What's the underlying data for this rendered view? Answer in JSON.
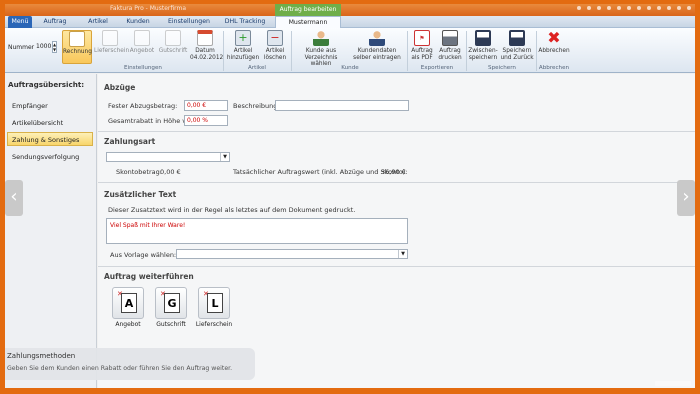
{
  "titlebar": {
    "title": "Faktura Pro - Musterfirma",
    "context_tab": "Auftrag bearbeiten"
  },
  "tabs": [
    "Menü",
    "Auftrag",
    "Artikel",
    "Kunden",
    "Einstellungen",
    "DHL Tracking",
    "Mustermann"
  ],
  "ribbon": {
    "number_label": "Nummer",
    "number_value": "1000",
    "buttons": [
      {
        "label": "Rechnung",
        "icon": "document-r-icon"
      },
      {
        "label": "Lieferschein",
        "icon": "document-l-icon"
      },
      {
        "label": "Angebot",
        "icon": "document-a-icon"
      },
      {
        "label": "Gutschrift",
        "icon": "document-g-icon"
      },
      {
        "label": "Datum",
        "sub": "04.02.2012",
        "icon": "calendar-icon"
      },
      {
        "label": "Artikel",
        "sub": "hinzufügen",
        "icon": "cart-add-icon"
      },
      {
        "label": "Artikel",
        "sub": "löschen",
        "icon": "cart-remove-icon"
      },
      {
        "label": "Kunde aus",
        "sub": "Verzeichnis wählen",
        "icon": "customer-icon"
      },
      {
        "label": "Kundendaten",
        "sub": "selber eintragen",
        "icon": "customer-edit-icon"
      },
      {
        "label": "Auftrag",
        "sub": "als PDF",
        "icon": "pdf-icon"
      },
      {
        "label": "Auftrag",
        "sub": "drucken",
        "icon": "printer-icon"
      },
      {
        "label": "Zwischen-",
        "sub": "speichern",
        "icon": "save-icon"
      },
      {
        "label": "Speichern",
        "sub": "und Zurück",
        "icon": "save-back-icon"
      },
      {
        "label": "Abbrechen",
        "icon": "cancel-icon"
      }
    ],
    "groups": [
      "Einstellungen",
      "Artikel",
      "Kunde",
      "Exportieren",
      "Speichern",
      "Abbrechen"
    ]
  },
  "sidebar": {
    "title": "Auftragsübersicht:",
    "items": [
      "Empfänger",
      "Artikelübersicht",
      "Zahlung & Sonstiges",
      "Sendungsverfolgung"
    ]
  },
  "abzuege": {
    "title": "Abzüge",
    "fester_label": "Fester Abzugsbetrag:",
    "fester_value": "0,00 €",
    "beschreibung_label": "Beschreibung:",
    "beschreibung_value": "",
    "rabatt_label": "Gesamtrabatt in Höhe von",
    "rabatt_value": "0,00 %"
  },
  "zahlungsart": {
    "title": "Zahlungsart",
    "select_value": "",
    "skonto_label": "Skontobetrag:",
    "skonto_value": "0,00 €",
    "total_label": "Tatsächlicher Auftragswert (inkl. Abzüge und Skonto):",
    "total_value": "36,90 €"
  },
  "zusatz": {
    "title": "Zusätzlicher Text",
    "hint": "Dieser Zusatztext wird in der Regel als letztes auf dem Dokument gedruckt.",
    "text": "Viel Spaß mit Ihrer Ware!",
    "vorlage_label": "Aus Vorlage wählen:"
  },
  "weiter": {
    "title": "Auftrag weiterführen",
    "docs": [
      {
        "letter": "A",
        "label": "Angebot"
      },
      {
        "letter": "G",
        "label": "Gutschrift"
      },
      {
        "letter": "L",
        "label": "Lieferschein"
      }
    ]
  },
  "status": {
    "title": "Zahlungsmethoden",
    "text": "Geben Sie dem Kunden einen Rabatt oder führen Sie den Auftrag weiter."
  },
  "colors": {
    "accent": "#e36b10",
    "ribbon_blue": "#2b66b7",
    "selected": "#f9c85b"
  }
}
